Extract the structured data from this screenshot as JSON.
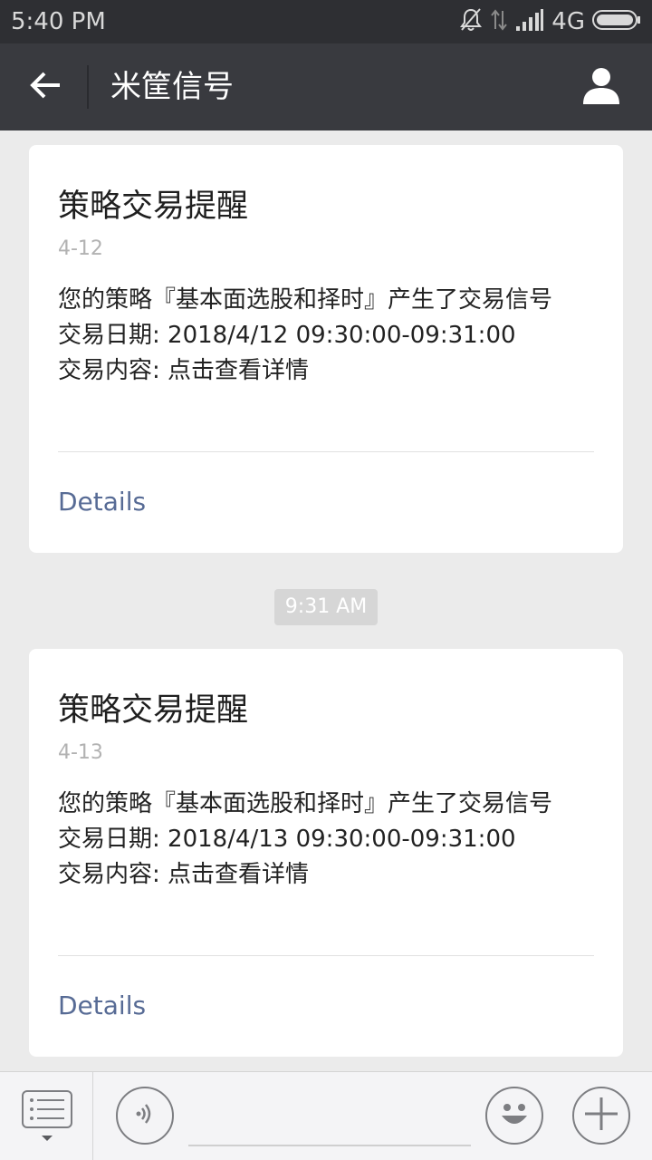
{
  "status_bar": {
    "time": "5:40 PM",
    "network": "4G"
  },
  "nav": {
    "title": "米筐信号"
  },
  "messages": [
    {
      "title": "策略交易提醒",
      "date": "4-12",
      "lines": [
        "您的策略『基本面选股和择时』产生了交易信号",
        "交易日期: 2018/4/12 09:30:00-09:31:00",
        "交易内容: 点击查看详情"
      ],
      "details_label": "Details"
    },
    {
      "title": "策略交易提醒",
      "date": "4-13",
      "lines": [
        "您的策略『基本面选股和择时』产生了交易信号",
        "交易日期: 2018/4/13 09:30:00-09:31:00",
        "交易内容: 点击查看详情"
      ],
      "details_label": "Details"
    }
  ],
  "timestamp": "9:31 AM",
  "bottom_bar": {
    "menu_icon": "menu-list-icon",
    "voice_icon": "voice-icon",
    "emoji_icon": "emoji-icon",
    "plus_icon": "plus-icon"
  }
}
